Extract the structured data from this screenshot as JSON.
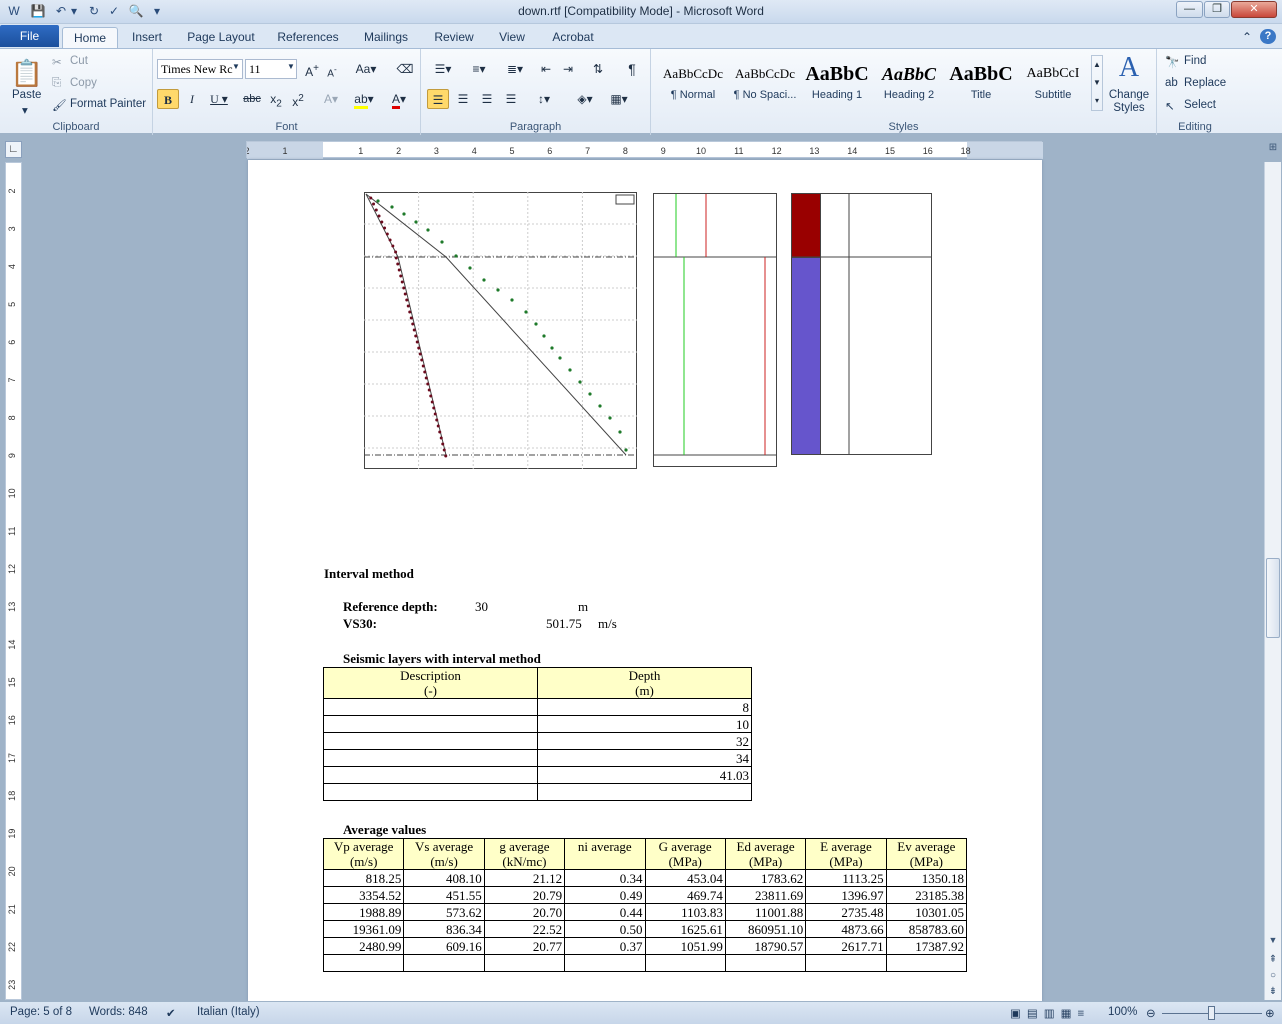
{
  "window": {
    "title": "down.rtf [Compatibility Mode]  -  Microsoft Word"
  },
  "tabs": [
    "File",
    "Home",
    "Insert",
    "Page Layout",
    "References",
    "Mailings",
    "Review",
    "View",
    "Acrobat"
  ],
  "clipboard": {
    "paste": "Paste",
    "cut": "Cut",
    "copy": "Copy",
    "format_painter": "Format Painter",
    "label": "Clipboard"
  },
  "font": {
    "name": "Times New Rc",
    "size": "11",
    "label": "Font",
    "case_label": "Aa"
  },
  "paragraph": {
    "label": "Paragraph"
  },
  "styles": {
    "items": [
      {
        "sample": "AaBbCcDc",
        "name": "¶ Normal"
      },
      {
        "sample": "AaBbCcDc",
        "name": "¶ No Spaci..."
      },
      {
        "sample": "AaBbC",
        "name": "Heading 1"
      },
      {
        "sample": "AaBbC",
        "name": "Heading 2"
      },
      {
        "sample": "AaBbC",
        "name": "Title"
      },
      {
        "sample": "AaBbCcI",
        "name": "Subtitle"
      }
    ],
    "change_styles": "Change Styles",
    "label": "Styles"
  },
  "editing": {
    "find": "Find",
    "replace": "Replace",
    "select": "Select",
    "label": "Editing"
  },
  "ruler": {
    "h_marks": [
      "2",
      "1",
      "1",
      "2",
      "3",
      "4",
      "5",
      "6",
      "7",
      "8",
      "9",
      "10",
      "11",
      "12",
      "13",
      "14",
      "15",
      "16",
      "18"
    ],
    "v_marks": [
      "2",
      "3",
      "4",
      "5",
      "6",
      "7",
      "8",
      "9",
      "10",
      "11",
      "12",
      "13",
      "14",
      "15",
      "16",
      "17",
      "18",
      "19",
      "20",
      "21",
      "22",
      "23"
    ]
  },
  "colors": {
    "ribbon_bg": "#e4ecf6",
    "file_tab": "#1b4f9c",
    "table_header": "#ffffc8",
    "series_green": "#1e7a2a",
    "series_darkred": "#6b0b1e",
    "layer1": "#990000",
    "layer2": "#6655cc"
  },
  "document": {
    "interval_heading": "Interval method",
    "ref_depth_label": "Reference depth:",
    "ref_depth_value": "30",
    "ref_depth_unit": "m",
    "vs30_label": "VS30:",
    "vs30_value": "501.75",
    "vs30_unit": "m/s",
    "layers_heading": "Seismic layers with interval method",
    "layers_table": {
      "headers": [
        [
          "Description",
          "(-)"
        ],
        [
          "Depth",
          "(m)"
        ]
      ],
      "rows": [
        [
          "",
          "8"
        ],
        [
          "",
          "10"
        ],
        [
          "",
          "32"
        ],
        [
          "",
          "34"
        ],
        [
          "",
          "41.03"
        ],
        [
          "",
          ""
        ]
      ]
    },
    "avg_heading": "Average values",
    "avg_table": {
      "headers": [
        [
          "Vp average",
          "(m/s)"
        ],
        [
          "Vs average",
          "(m/s)"
        ],
        [
          "g average",
          "(kN/mc)"
        ],
        [
          "ni average",
          ""
        ],
        [
          "G average",
          "(MPa)"
        ],
        [
          "Ed average",
          "(MPa)"
        ],
        [
          "E average",
          "(MPa)"
        ],
        [
          "Ev average",
          "(MPa)"
        ]
      ],
      "rows": [
        [
          "818.25",
          "408.10",
          "21.12",
          "0.34",
          "453.04",
          "1783.62",
          "1113.25",
          "1350.18"
        ],
        [
          "3354.52",
          "451.55",
          "20.79",
          "0.49",
          "469.74",
          "23811.69",
          "1396.97",
          "23185.38"
        ],
        [
          "1988.89",
          "573.62",
          "20.70",
          "0.44",
          "1103.83",
          "11001.88",
          "2735.48",
          "10301.05"
        ],
        [
          "19361.09",
          "836.34",
          "22.52",
          "0.50",
          "1625.61",
          "860951.10",
          "4873.66",
          "858783.60"
        ],
        [
          "2480.99",
          "609.16",
          "20.77",
          "0.37",
          "1051.99",
          "18790.57",
          "2617.71",
          "17387.92"
        ],
        [
          "",
          "",
          "",
          "",
          "",
          "",
          "",
          ""
        ]
      ]
    }
  },
  "status": {
    "page": "Page: 5 of 8",
    "words": "Words: 848",
    "language": "Italian (Italy)",
    "zoom": "100%"
  }
}
